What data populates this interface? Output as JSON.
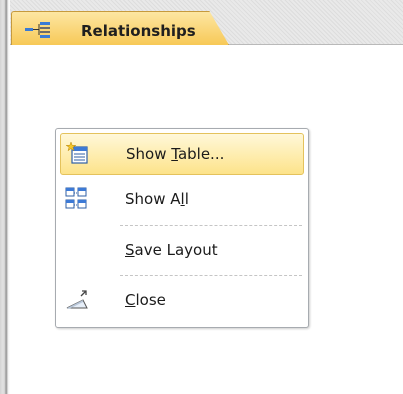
{
  "tab": {
    "label": "Relationships",
    "icon": "relationships-icon"
  },
  "context_menu": {
    "items": [
      {
        "label_pre": "Show ",
        "label_key": "T",
        "label_post": "able...",
        "icon": "show-table-icon",
        "highlighted": true
      },
      {
        "label_pre": "Show A",
        "label_key": "l",
        "label_post": "l",
        "icon": "show-all-icon"
      },
      {
        "label_pre": "",
        "label_key": "S",
        "label_post": "ave Layout",
        "icon": ""
      },
      {
        "label_pre": "",
        "label_key": "C",
        "label_post": "lose",
        "icon": "close-icon"
      }
    ]
  },
  "colors": {
    "tab_fill": "#f9d36e",
    "highlight": "#fde38a",
    "menu_border": "#a7abb0"
  }
}
